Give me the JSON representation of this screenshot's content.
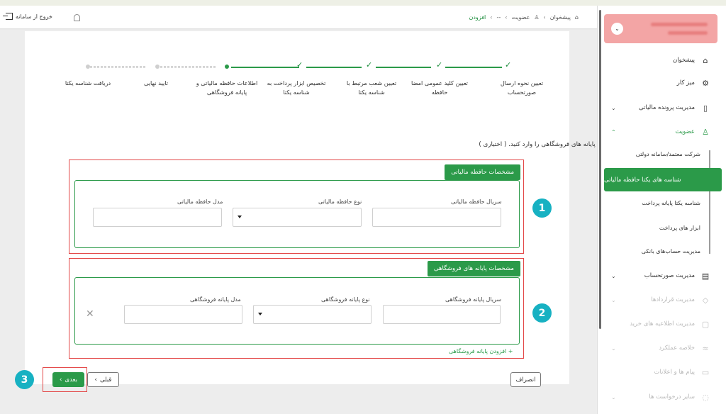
{
  "header": {
    "logout_label": "خروج از سامانه",
    "breadcrumb": [
      "پیشخوان",
      "عضویت",
      "--",
      "افزودن"
    ]
  },
  "stepper": {
    "steps": [
      {
        "label_line1": "تعیین نحوه ارسال",
        "label_line2": "صورتحساب",
        "status": "done"
      },
      {
        "label_line1": "تعیین کلید عمومی امضا",
        "label_line2": "حافظه",
        "status": "done"
      },
      {
        "label_line1": "تعیین شعب مرتبط با",
        "label_line2": "شناسه یکتا",
        "status": "done"
      },
      {
        "label_line1": "تخصیص ابزار پرداخت به",
        "label_line2": "شناسه یکتا",
        "status": "done"
      },
      {
        "label_line1": "اطلاعات حافظه مالیاتی و",
        "label_line2": "پایانه فروشگاهی",
        "status": "active"
      },
      {
        "label_line1": "تایید نهایی",
        "label_line2": "",
        "status": "pending"
      },
      {
        "label_line1": "دریافت شناسه یکتا",
        "label_line2": "",
        "status": "pending"
      }
    ]
  },
  "instruction": "لطفا اطلاعات حافظه مالیاتی و پایانه های فروشگاهی را وارد کنید. ( اختیاری )",
  "section1": {
    "title": "مشخصات حافظه مالیاتی",
    "serial_label": "سریال حافظه مالیاتی",
    "type_label": "نوع حافظه مالیاتی",
    "model_label": "مدل حافظه مالیاتی",
    "serial_value": "",
    "type_value": "",
    "model_value": ""
  },
  "section2": {
    "title": "مشخصات پایانه های فروشگاهی",
    "serial_label": "سریال پایانه فروشگاهی",
    "type_label": "نوع پایانه فروشگاهی",
    "model_label": "مدل پایانه فروشگاهی",
    "serial_value": "",
    "type_value": "",
    "model_value": "",
    "add_label": "افزودن پایانه فروشگاهی"
  },
  "buttons": {
    "next": "بعدی",
    "prev": "قبلی",
    "cancel": "انصراف"
  },
  "badges": [
    "1",
    "2",
    "3"
  ],
  "sidebar": {
    "menu": [
      {
        "label": "پیشخوان",
        "icon": "home-icon"
      },
      {
        "label": "میز کار",
        "icon": "workspace-icon"
      },
      {
        "label": "مدیریت پرونده مالیاتی",
        "icon": "file-icon"
      },
      {
        "label": "عضویت",
        "icon": "user-icon"
      },
      {
        "label": "مدیریت صورتحساب",
        "icon": "invoice-icon"
      },
      {
        "label": "مدیریت قراردادها",
        "icon": "contract-icon"
      },
      {
        "label": "مدیریت اطلاعیه های خرید",
        "icon": "clipboard-icon"
      },
      {
        "label": "خلاصه عملکرد",
        "icon": "chart-icon"
      },
      {
        "label": "پیام ها و اعلانات",
        "icon": "message-icon"
      },
      {
        "label": "سایر درخواست ها",
        "icon": "request-icon"
      }
    ],
    "submenu": [
      "شرکت معتمد/سامانه دولتی",
      "شناسه های یکتا حافظه مالیاتی",
      "شناسه یکتا پایانه پرداخت",
      "ابزار های پرداخت",
      "مدیریت حساب‌های بانکی"
    ]
  },
  "colors": {
    "accent": "#2b9a49",
    "highlight": "#e34848",
    "badge": "#17b1c2"
  }
}
